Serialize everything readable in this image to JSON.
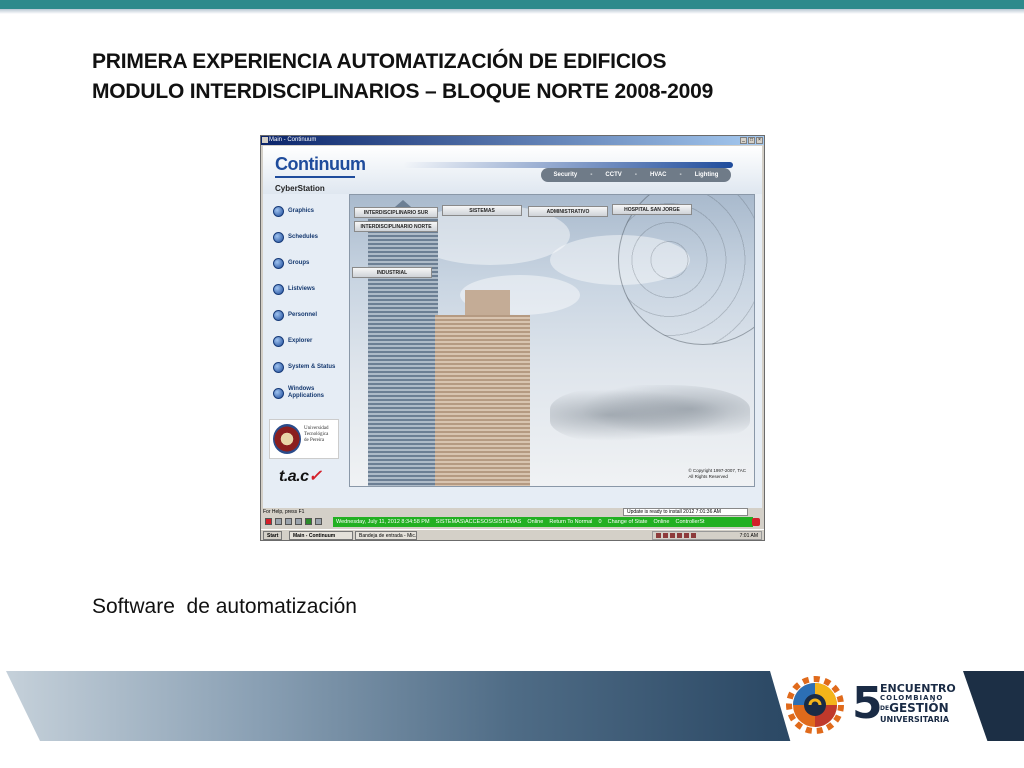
{
  "slide": {
    "title_line1": "PRIMERA EXPERIENCIA AUTOMATIZACIÓN DE EDIFICIOS",
    "title_line2": "MODULO INTERDISCIPLINARIOS – BLOQUE NORTE  2008-2009",
    "caption": "Software  de automatización"
  },
  "event_logo": {
    "number": "5",
    "line1": "ENCUENTRO",
    "line2": "COLOMBIANO",
    "de": "DE",
    "line3": "GESTIÓN",
    "line4": "UNIVERSITARIA"
  },
  "window": {
    "title": "Main - Continuum",
    "controls": [
      "_",
      "□",
      "×"
    ]
  },
  "app": {
    "brand": "Continuum",
    "subbrand": "CyberStation",
    "topnav": [
      "Security",
      "CCTV",
      "HVAC",
      "Lighting"
    ],
    "sidebar": [
      {
        "label": "Graphics",
        "icon": "graphics-icon"
      },
      {
        "label": "Schedules",
        "icon": "schedules-icon"
      },
      {
        "label": "Groups",
        "icon": "groups-icon"
      },
      {
        "label": "Listviews",
        "icon": "listviews-icon"
      },
      {
        "label": "Personnel",
        "icon": "personnel-icon"
      },
      {
        "label": "Explorer",
        "icon": "explorer-icon"
      },
      {
        "label": "System & Status",
        "icon": "system-status-icon"
      },
      {
        "label": "Windows Applications",
        "icon": "windows-applications-icon"
      }
    ],
    "university": {
      "line1": "Universidad",
      "line2": "Tecnológica",
      "line3": "de Pereira"
    },
    "tac": {
      "text": "t.a.c"
    },
    "buildings": [
      "INTERDISCIPLINARIO SUR",
      "SISTEMAS",
      "ADMINISTRATIVO",
      "HOSPITAL SAN JORGE",
      "INTERDISCIPLINARIO NORTE",
      "INDUSTRIAL"
    ],
    "copyright_line1": "© Copyright 1997-2007, TAC",
    "copyright_line2": "All Rights Reserved"
  },
  "status": {
    "help": "For Help, press F1",
    "update": "Update is ready to install",
    "update_date": "2012",
    "update_time": "7:01:36 AM",
    "alarm_message": "Wednesday, July 11, 2012 8:34:58 PM    SISTEMAS\\ACCESOS\\SISTEMAS    Online    Return To Normal    0    Change of State    Online    ControllerSt"
  },
  "taskbar": {
    "start": "Start",
    "tasks": [
      "Main - Continuum",
      "Bandeja de entrada - Mic..."
    ],
    "clock": "7:01 AM"
  },
  "colors": {
    "accent_top": "#2e8a8c",
    "brand_blue": "#1f4c9c",
    "alarm_green": "#22b022"
  }
}
